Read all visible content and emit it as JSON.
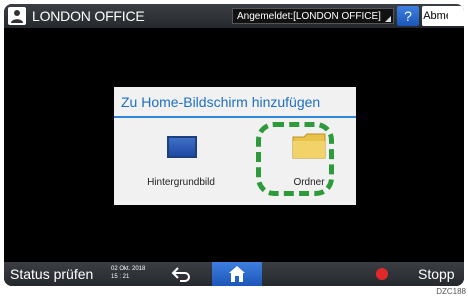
{
  "topbar": {
    "office_label": "LONDON OFFICE",
    "login_status": "Angemeldet:[LONDON OFFICE]",
    "help_label": "?",
    "logout_label": "Abmelden"
  },
  "dialog": {
    "title": "Zu Home-Bildschirm hinzufügen",
    "options": [
      {
        "label": "Hintergrundbild",
        "icon": "monitor-icon"
      },
      {
        "label": "Ordner",
        "icon": "folder-icon"
      }
    ]
  },
  "bottombar": {
    "status_label": "Status prüfen",
    "date": "02 Okt. 2018",
    "time": "15 : 21",
    "stop_label": "Stopp"
  },
  "figure_code": "DZC188",
  "colors": {
    "accent_blue": "#1f6fc3",
    "highlight_green": "#2e9b3b",
    "stop_red": "#e02a2a"
  }
}
